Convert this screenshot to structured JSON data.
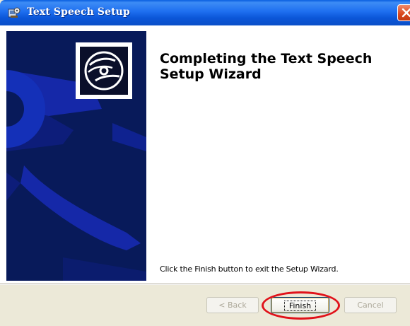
{
  "window": {
    "title": "Text Speech Setup",
    "icon": "setup-icon"
  },
  "content": {
    "heading": "Completing the Text Speech Setup Wizard",
    "instruction": "Click the Finish button to exit the Setup Wizard."
  },
  "buttons": {
    "back": {
      "label": "< Back",
      "enabled": false
    },
    "finish": {
      "label": "Finish",
      "enabled": true
    },
    "cancel": {
      "label": "Cancel",
      "enabled": false
    }
  },
  "annotation": {
    "highlight_color": "#e0121a",
    "target": "finish-button"
  },
  "colors": {
    "titlebar": "#0a56d8",
    "banner": "#081a5a",
    "dialog_face": "#ece9d8"
  }
}
